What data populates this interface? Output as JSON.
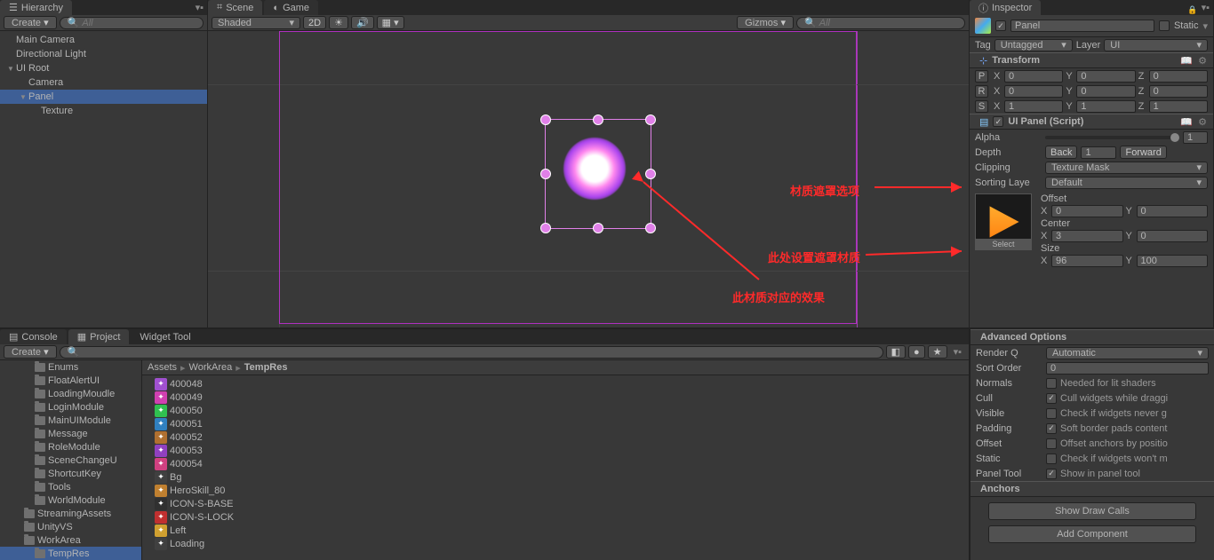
{
  "hierarchy": {
    "tab": "Hierarchy",
    "create": "Create",
    "search_placeholder": "All",
    "items": [
      {
        "name": "Main Camera",
        "indent": 0
      },
      {
        "name": "Directional Light",
        "indent": 0
      },
      {
        "name": "UI Root",
        "indent": 0,
        "arrow": "open"
      },
      {
        "name": "Camera",
        "indent": 1
      },
      {
        "name": "Panel",
        "indent": 1,
        "arrow": "open",
        "selected": true
      },
      {
        "name": "Texture",
        "indent": 2
      }
    ]
  },
  "scene": {
    "tab_scene": "Scene",
    "tab_game": "Game",
    "shaded": "Shaded",
    "mode2d": "2D",
    "gizmos": "Gizmos",
    "search_placeholder": "All"
  },
  "annotations": {
    "a1": "材质遮罩选项",
    "a2": "此处设置遮罩材质",
    "a3": "此材质对应的效果"
  },
  "inspector": {
    "tab": "Inspector",
    "name": "Panel",
    "static": "Static",
    "tag_lbl": "Tag",
    "tag_val": "Untagged",
    "layer_lbl": "Layer",
    "layer_val": "UI",
    "transform": {
      "title": "Transform",
      "P": "P",
      "R": "R",
      "S": "S",
      "pos": {
        "x": "0",
        "y": "0",
        "z": "0"
      },
      "rot": {
        "x": "0",
        "y": "0",
        "z": "0"
      },
      "scl": {
        "x": "1",
        "y": "1",
        "z": "1"
      }
    },
    "uipanel": {
      "title": "UI Panel (Script)",
      "alpha": "Alpha",
      "alpha_v": "1",
      "depth": "Depth",
      "back": "Back",
      "depth_v": "1",
      "forward": "Forward",
      "clipping": "Clipping",
      "clipping_v": "Texture Mask",
      "sorting": "Sorting Laye",
      "sorting_v": "Default",
      "offset": "Offset",
      "offX": "0",
      "offY": "0",
      "center": "Center",
      "cenX": "3",
      "cenY": "0",
      "size": "Size",
      "sizX": "96",
      "sizY": "100",
      "select": "Select"
    },
    "adv": {
      "title": "Advanced Options",
      "renderq": "Render Q",
      "renderq_v": "Automatic",
      "sortorder": "Sort Order",
      "sortorder_v": "0",
      "normals": "Normals",
      "normals_t": "Needed for lit shaders",
      "cull": "Cull",
      "cull_t": "Cull widgets while draggi",
      "visible": "Visible",
      "visible_t": "Check if widgets never g",
      "padding": "Padding",
      "padding_t": "Soft border pads content",
      "offset": "Offset",
      "offset_t": "Offset anchors by positio",
      "static": "Static",
      "static_t": "Check if widgets won't m",
      "paneltool": "Panel Tool",
      "paneltool_t": "Show in panel tool"
    },
    "anchors": "Anchors",
    "showdraw": "Show Draw Calls",
    "addcomp": "Add Component"
  },
  "bottom": {
    "tabs": {
      "console": "Console",
      "project": "Project",
      "widget": "Widget Tool"
    },
    "create": "Create",
    "folders": [
      {
        "name": "Enums",
        "i": 2
      },
      {
        "name": "FloatAlertUI",
        "i": 2
      },
      {
        "name": "LoadingMoudle",
        "i": 2
      },
      {
        "name": "LoginModule",
        "i": 2
      },
      {
        "name": "MainUIModule",
        "i": 2
      },
      {
        "name": "Message",
        "i": 2,
        "arrow": true
      },
      {
        "name": "RoleModule",
        "i": 2,
        "arrow": true
      },
      {
        "name": "SceneChangeU",
        "i": 2
      },
      {
        "name": "ShortcutKey",
        "i": 2
      },
      {
        "name": "Tools",
        "i": 2,
        "arrow": true
      },
      {
        "name": "WorldModule",
        "i": 2
      },
      {
        "name": "StreamingAssets",
        "i": 1,
        "arrow": true
      },
      {
        "name": "UnityVS",
        "i": 1,
        "arrow": true
      },
      {
        "name": "WorkArea",
        "i": 1,
        "arrow": "open"
      },
      {
        "name": "TempRes",
        "i": 2,
        "sel": true
      }
    ],
    "crumb": [
      "Assets",
      "WorkArea",
      "TempRes"
    ],
    "assets": [
      {
        "n": "400048",
        "c": "#a050d0"
      },
      {
        "n": "400049",
        "c": "#d040b0"
      },
      {
        "n": "400050",
        "c": "#30c050"
      },
      {
        "n": "400051",
        "c": "#3080c0"
      },
      {
        "n": "400052",
        "c": "#b07030"
      },
      {
        "n": "400053",
        "c": "#9040c0"
      },
      {
        "n": "400054",
        "c": "#d04080"
      },
      {
        "n": "Bg",
        "c": "#404040"
      },
      {
        "n": "HeroSkill_80",
        "c": "#c08030"
      },
      {
        "n": "ICON-S-BASE",
        "c": "#303030"
      },
      {
        "n": "ICON-S-LOCK",
        "c": "#c03030"
      },
      {
        "n": "Left",
        "c": "#d0a030"
      },
      {
        "n": "Loading",
        "c": "#404040"
      }
    ]
  }
}
